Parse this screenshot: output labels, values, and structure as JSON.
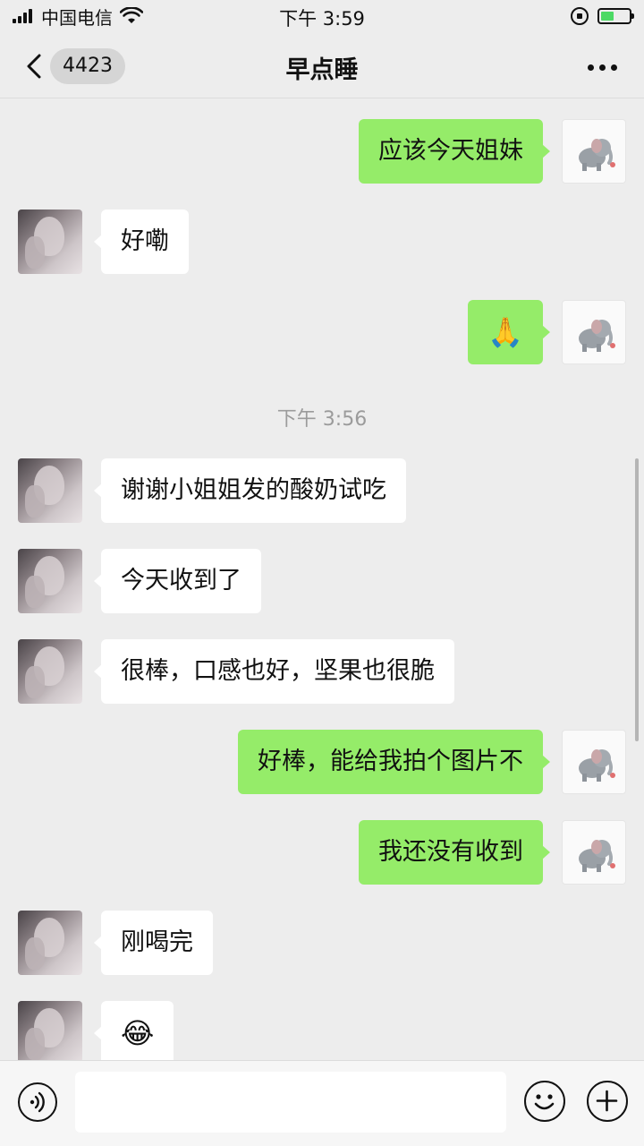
{
  "status_bar": {
    "carrier": "中国电信",
    "time": "下午 3:59",
    "battery_level": 0.45,
    "signal_bars": 4
  },
  "nav": {
    "back_badge": "4423",
    "title": "早点睡",
    "more_icon": "more-horizontal-icon"
  },
  "messages": [
    {
      "side": "right",
      "text": "应该今天姐妹"
    },
    {
      "side": "left",
      "text": "好嘞"
    },
    {
      "side": "right",
      "text": "🙏"
    },
    {
      "side": "left",
      "text": "谢谢小姐姐发的酸奶试吃"
    },
    {
      "side": "left",
      "text": "今天收到了"
    },
    {
      "side": "left",
      "text": "很棒，口感也好，坚果也很脆"
    },
    {
      "side": "right",
      "text": "好棒，能给我拍个图片不"
    },
    {
      "side": "right",
      "text": "我还没有收到"
    },
    {
      "side": "left",
      "text": "刚喝完"
    },
    {
      "side": "left",
      "text": "😂"
    }
  ],
  "timestamp": "下午 3:56",
  "input_bar": {
    "voice_icon": "voice-icon",
    "emoji_icon": "emoji-icon",
    "plus_icon": "plus-icon",
    "input_value": ""
  },
  "colors": {
    "background": "#ededed",
    "sent_bubble": "#95ec69",
    "received_bubble": "#ffffff",
    "timestamp_text": "#9b9b9b",
    "battery_fill": "#4cd964"
  }
}
